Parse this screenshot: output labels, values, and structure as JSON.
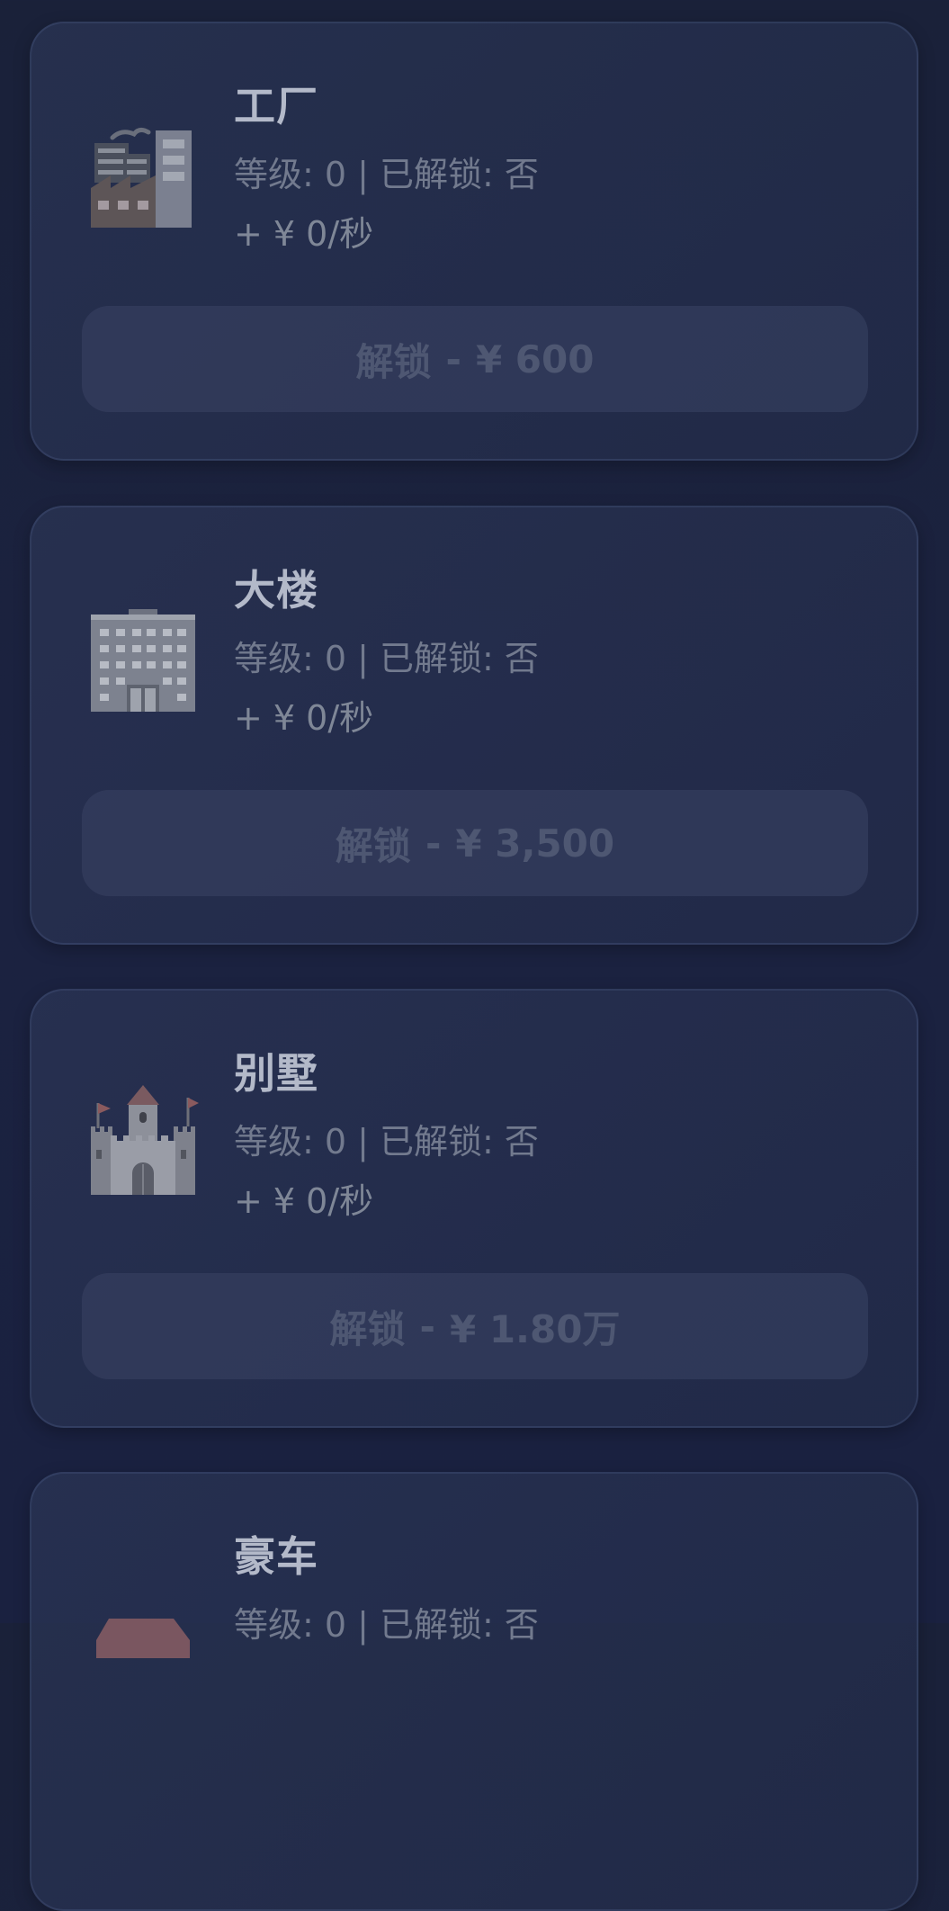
{
  "assets": [
    {
      "title": "工厂",
      "icon": "factory-icon",
      "meta": "等级: 0 | 已解锁: 否",
      "rate": "+ ¥ 0/秒",
      "unlock_label": "解锁",
      "unlock_price": "¥ 600"
    },
    {
      "title": "大楼",
      "icon": "office-building-icon",
      "meta": "等级: 0 | 已解锁: 否",
      "rate": "+ ¥ 0/秒",
      "unlock_label": "解锁",
      "unlock_price": "¥ 3,500"
    },
    {
      "title": "别墅",
      "icon": "castle-icon",
      "meta": "等级: 0 | 已解锁: 否",
      "rate": "+ ¥ 0/秒",
      "unlock_label": "解锁",
      "unlock_price": "¥ 1.80万"
    },
    {
      "title": "豪车",
      "icon": "car-icon",
      "meta": "等级: 0 | 已解锁: 否",
      "rate": "",
      "unlock_label": "",
      "unlock_price": ""
    }
  ],
  "colors": {
    "background": "#1a2139",
    "card": "#2a3454",
    "title_text": "#b3b9c9",
    "meta_text": "#727a8e",
    "button_bg": "#3a4464",
    "button_text": "#4e5772"
  }
}
